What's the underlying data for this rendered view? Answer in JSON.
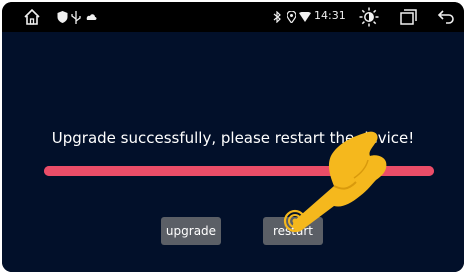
{
  "statusbar": {
    "time": "14:31",
    "left_icons": [
      "home-icon",
      "shield-icon",
      "usb-icon",
      "cloud-icon"
    ],
    "right_icons": [
      "bluetooth-icon",
      "location-icon",
      "wifi-icon",
      "brightness-icon",
      "recent-apps-icon",
      "back-icon"
    ]
  },
  "main": {
    "message": "Upgrade successfully, please restart the device!",
    "progress": 1.0
  },
  "buttons": {
    "upgrade_label": "upgrade",
    "restart_label": "restart"
  },
  "colors": {
    "background": "#02102a",
    "progress": "#e23a57",
    "button": "#5b5f66",
    "hand": "#f5b81d"
  }
}
